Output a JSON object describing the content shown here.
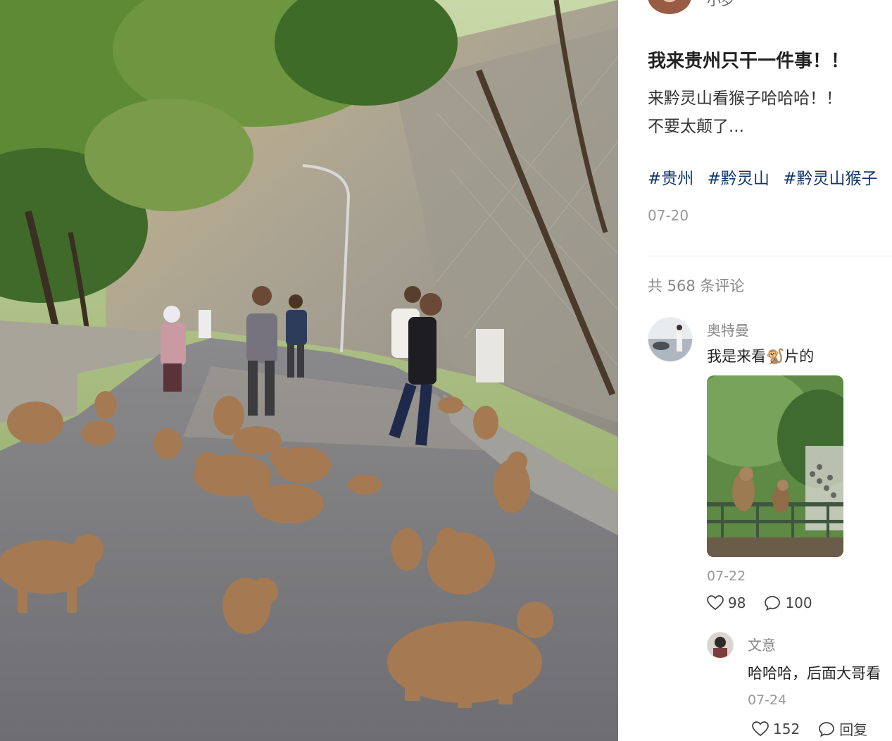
{
  "post": {
    "author_name": "小罗",
    "title": "我来贵州只干一件事！！",
    "body_lines": [
      "来黔灵山看猴子哈哈哈！！",
      "不要太颠了..."
    ],
    "tags": [
      "#贵州",
      "#黔灵山",
      "#黔灵山猴子",
      "#"
    ],
    "date": "07-20"
  },
  "comments_header": "共 568 条评论",
  "comments": [
    {
      "name": "奥特曼",
      "text_before": "我是来看",
      "text_after": "片的",
      "date": "07-22",
      "likes": "98",
      "replies": "100"
    },
    {
      "name": "文意",
      "text": "哈哈哈，后面大哥看",
      "date": "07-24",
      "likes": "152",
      "reply_label": "回复"
    }
  ],
  "icons": {
    "like": "heart-outline-icon",
    "comment": "speech-bubble-icon",
    "emoji": "monkey-emoji-icon"
  },
  "colors": {
    "tag": "#13386c",
    "muted": "#999999",
    "road": "#77777a",
    "foliage": "#4f7a2e",
    "cliff": "#a7a090"
  }
}
